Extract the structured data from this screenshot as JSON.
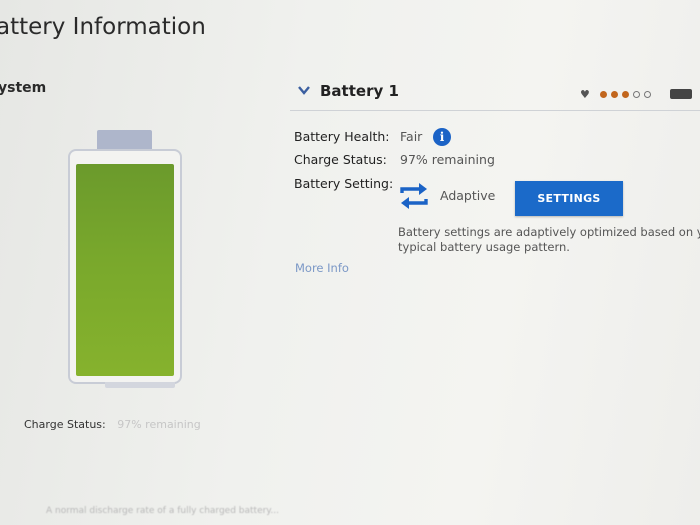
{
  "page": {
    "title": "attery Information",
    "section_label": "ystem"
  },
  "battery_graphic": {
    "charge_fraction": 0.97,
    "fill_color": "#79a82c",
    "charge_status_label": "Charge Status:",
    "charge_status_value": "97% remaining"
  },
  "battery_panel": {
    "title": "Battery 1",
    "expand_icon": "chevron-down-icon",
    "health_dots": {
      "filled": 3,
      "total": 5,
      "filled_color": "#c2661d"
    },
    "rows": {
      "health_label": "Battery Health:",
      "health_value": "Fair",
      "charge_label": "Charge Status:",
      "charge_value": "97% remaining",
      "setting_label": "Battery Setting:",
      "setting_value": "Adaptive"
    },
    "settings_button_label": "SETTINGS",
    "description_line1": "Battery settings are adaptively optimized based on yo",
    "description_line2": "typical battery usage pattern.",
    "more_info_link": "More Info"
  },
  "footer": {
    "text": "A normal discharge rate of a fully charged battery..."
  },
  "colors": {
    "accent": "#1b6ac9",
    "link": "#7b98c6",
    "battery_green": "#79a82c"
  }
}
